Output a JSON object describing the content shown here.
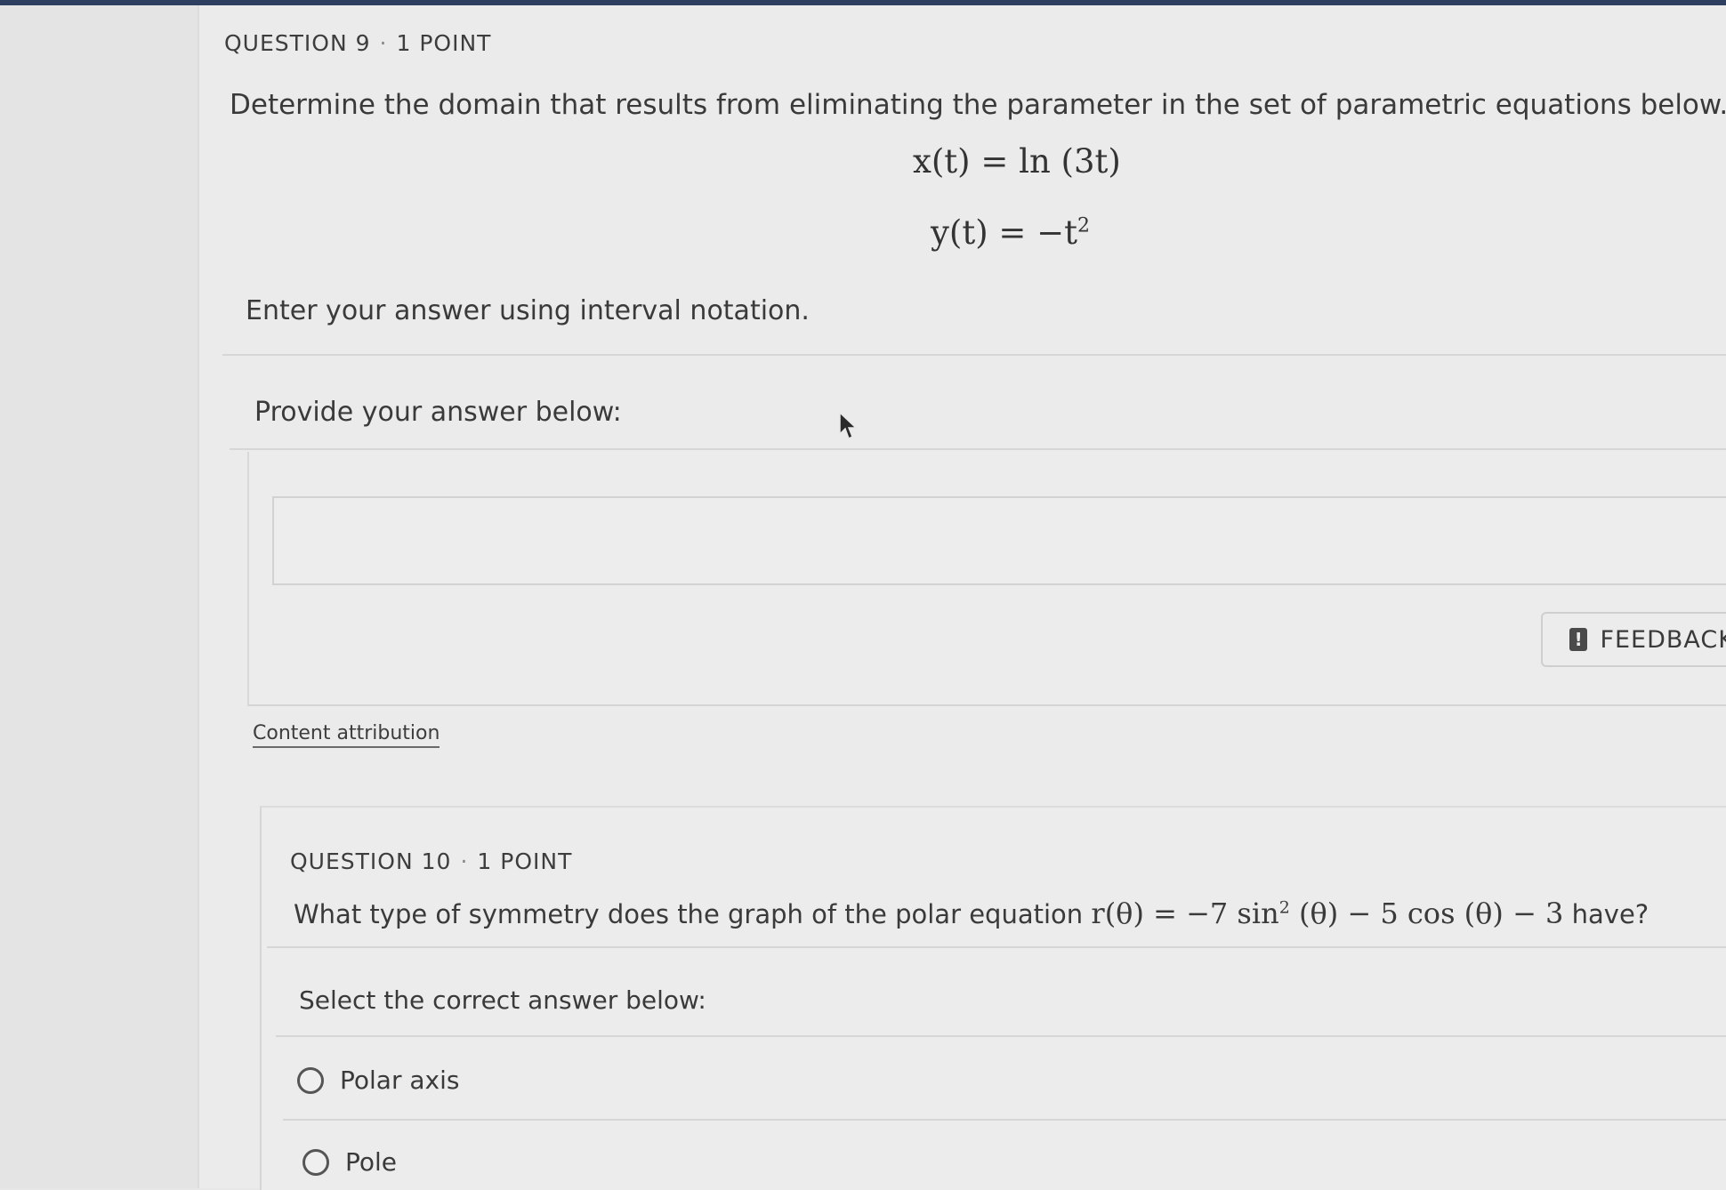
{
  "question9": {
    "number": "QUESTION 9",
    "separator": "·",
    "points": "1 POINT",
    "prompt": "Determine the domain that results from eliminating the parameter in the set of parametric equations below.",
    "equation_x": "x(t) = ln (3t)",
    "equation_y_base": "y(t) = −t",
    "equation_y_exp": "2",
    "instruction": "Enter your answer using interval notation.",
    "answer_label": "Provide your answer below:",
    "answer_value": "",
    "attribution": "Content attribution"
  },
  "feedback": {
    "label": "FEEDBACK",
    "icon": "exclamation-speech-icon"
  },
  "question10": {
    "number": "QUESTION 10",
    "separator": "·",
    "points": "1 POINT",
    "prompt_before": "What type of symmetry does the graph of the polar equation",
    "equation_main": "r(θ) = −7 sin",
    "equation_exp": "2",
    "equation_rest": "(θ) − 5 cos (θ) − 3",
    "prompt_after": "have?",
    "select_label": "Select the correct answer below:",
    "options": [
      {
        "label": "Polar axis",
        "selected": false
      },
      {
        "label": "Pole",
        "selected": false
      }
    ]
  }
}
